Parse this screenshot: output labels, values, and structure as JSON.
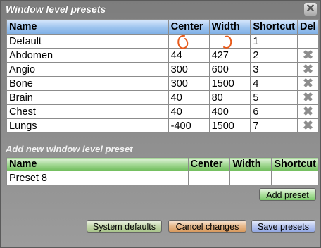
{
  "dialog": {
    "title": "Window level presets",
    "close_symbol": "✕"
  },
  "presets": {
    "columns": [
      "Name",
      "Center",
      "Width",
      "Shortcut",
      "Del"
    ],
    "rows": [
      {
        "name": "Default",
        "center": "",
        "width": "",
        "shortcut": "1",
        "deletable": false
      },
      {
        "name": "Abdomen",
        "center": "44",
        "width": "427",
        "shortcut": "2",
        "deletable": true
      },
      {
        "name": "Angio",
        "center": "300",
        "width": "600",
        "shortcut": "3",
        "deletable": true
      },
      {
        "name": "Bone",
        "center": "300",
        "width": "1500",
        "shortcut": "4",
        "deletable": true
      },
      {
        "name": "Brain",
        "center": "40",
        "width": "80",
        "shortcut": "5",
        "deletable": true
      },
      {
        "name": "Chest",
        "center": "40",
        "width": "400",
        "shortcut": "6",
        "deletable": true
      },
      {
        "name": "Lungs",
        "center": "-400",
        "width": "1500",
        "shortcut": "7",
        "deletable": true
      }
    ],
    "delete_icon": "✖",
    "annotation_color": "#e85a1a"
  },
  "new_preset": {
    "section_title": "Add new window level preset",
    "columns": [
      "Name",
      "Center",
      "Width",
      "Shortcut"
    ],
    "row": {
      "name": "Preset 8",
      "center": "",
      "width": "",
      "shortcut": ""
    },
    "add_label": "Add preset"
  },
  "footer": {
    "system_defaults": "System defaults",
    "cancel_changes": "Cancel changes",
    "save_presets": "Save presets"
  }
}
